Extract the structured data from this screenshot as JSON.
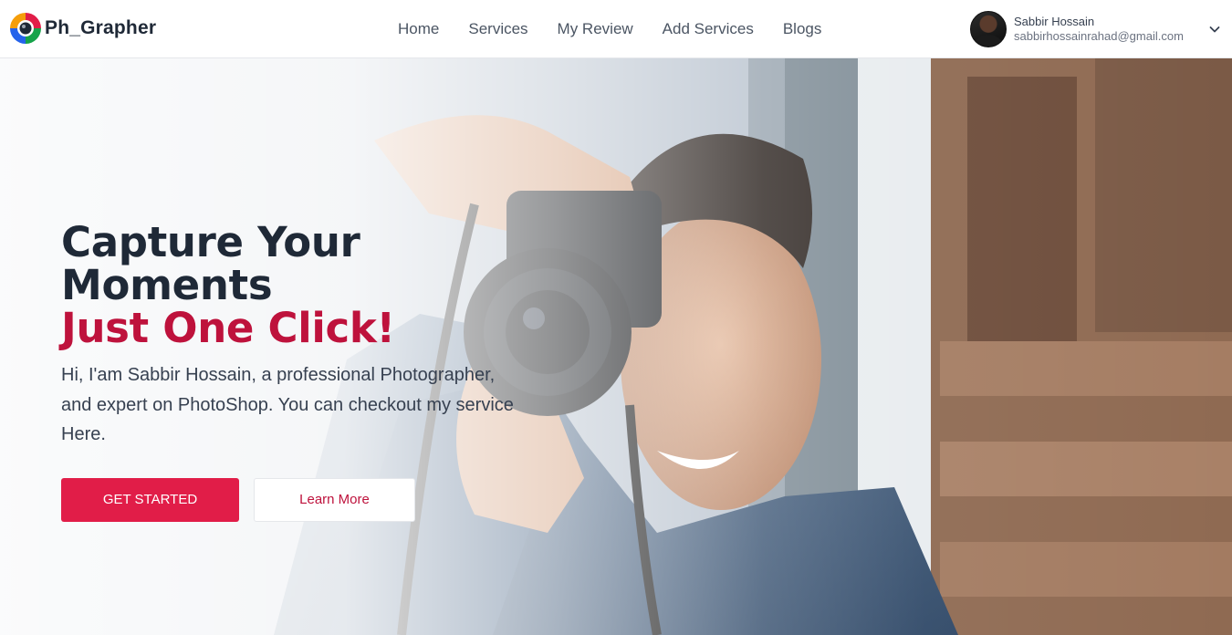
{
  "brand": {
    "name": "Ph_Grapher",
    "logo_icon": "camera-lens-logo-icon"
  },
  "nav": {
    "links": [
      "Home",
      "Services",
      "My Review",
      "Add Services",
      "Blogs"
    ]
  },
  "user": {
    "name": "Sabbir Hossain",
    "email": "sabbirhossainrahad@gmail.com",
    "menu_icon": "chevron-down-icon"
  },
  "hero": {
    "headline_line1": "Capture Your",
    "headline_line2": "Moments",
    "headline_accent": "Just One Click!",
    "description": "Hi, I'am Sabbir Hossain, a professional Photographer, and expert on PhotoShop. You can checkout my service Here.",
    "primary_button": "GET STARTED",
    "secondary_button": "Learn More"
  },
  "colors": {
    "accent": "#e11d48",
    "accent_text": "#be123c",
    "heading": "#1f2937",
    "nav_text": "#4b5563"
  }
}
